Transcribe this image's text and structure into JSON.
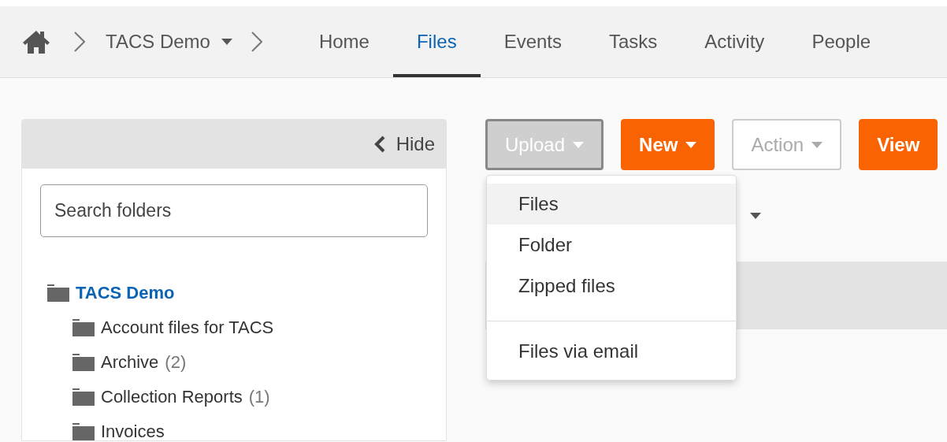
{
  "breadcrumb": {
    "items": [
      {
        "label": "TACS Demo",
        "dropdown": true
      }
    ]
  },
  "tabs": [
    {
      "label": "Home",
      "selected": false
    },
    {
      "label": "Files",
      "selected": true
    },
    {
      "label": "Events",
      "selected": false
    },
    {
      "label": "Tasks",
      "selected": false
    },
    {
      "label": "Activity",
      "selected": false
    },
    {
      "label": "People",
      "selected": false
    }
  ],
  "sidebar": {
    "hide_label": "Hide",
    "search": {
      "placeholder": "Search folders"
    },
    "tree": [
      {
        "name": "TACS Demo",
        "selected": true,
        "children": [
          {
            "name": "Account files for TACS",
            "selected": false
          },
          {
            "name": "Archive",
            "count": "(2)",
            "selected": false
          },
          {
            "name": "Collection Reports",
            "count": "(1)",
            "selected": false
          },
          {
            "name": "Invoices",
            "selected": false
          }
        ]
      }
    ]
  },
  "toolbar": {
    "buttons": [
      {
        "label": "Upload",
        "kind": "pressed",
        "dropdown": true
      },
      {
        "label": "New",
        "kind": "primary",
        "dropdown": true
      },
      {
        "label": "Action",
        "kind": "default",
        "dropdown": true
      },
      {
        "label": "View",
        "kind": "primary",
        "dropdown": false
      }
    ]
  },
  "upload_menu": {
    "items": [
      {
        "label": "Files",
        "selected": true,
        "separated_above": false
      },
      {
        "label": "Folder",
        "selected": false,
        "separated_above": false
      },
      {
        "label": "Zipped files",
        "selected": false,
        "separated_above": false
      },
      {
        "label": "Files via email",
        "selected": false,
        "separated_above": true
      }
    ]
  }
}
